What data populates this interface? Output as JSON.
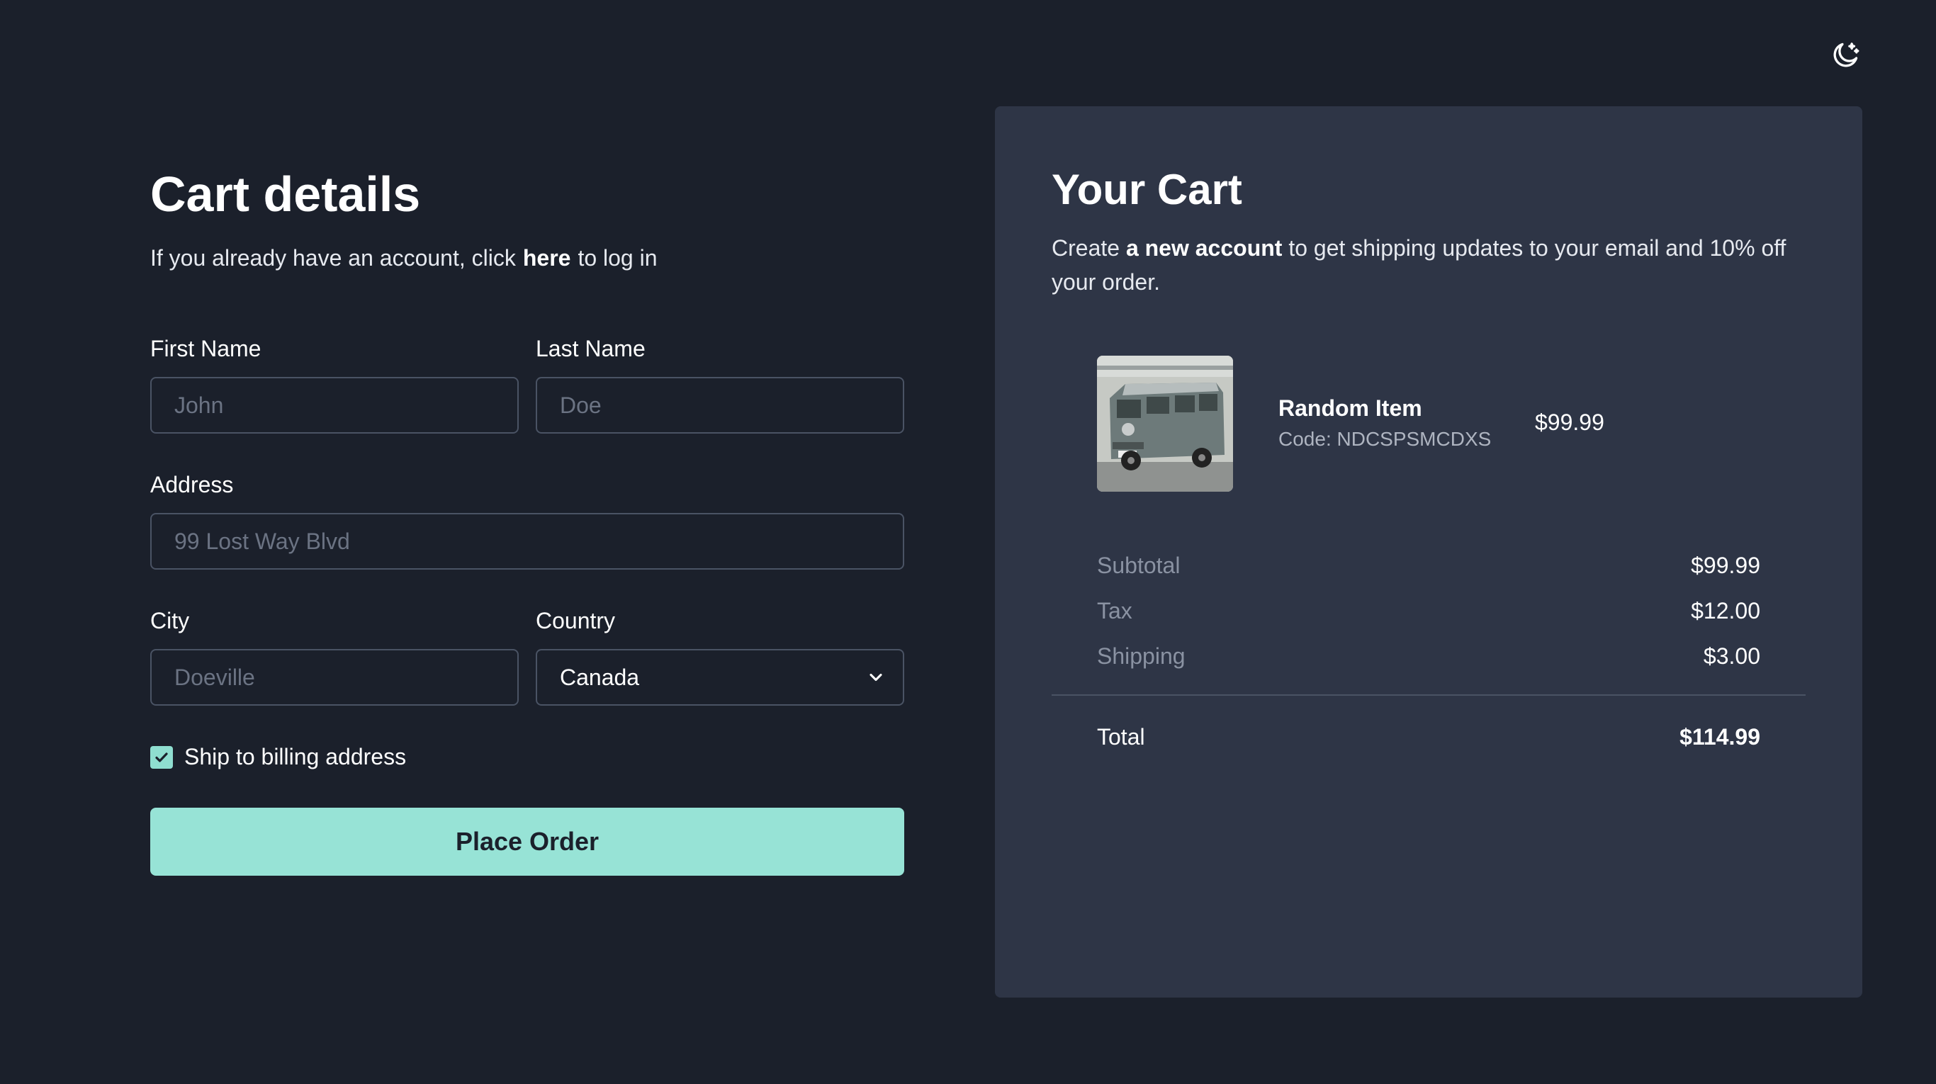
{
  "header": {
    "theme_toggle_icon": "moon-icon"
  },
  "checkout": {
    "title": "Cart details",
    "login_prompt_before": "If you already have an account, click",
    "login_link": "here",
    "login_prompt_after": "to log in",
    "first_name": {
      "label": "First Name",
      "placeholder": "John"
    },
    "last_name": {
      "label": "Last Name",
      "placeholder": "Doe"
    },
    "address": {
      "label": "Address",
      "placeholder": "99 Lost Way Blvd"
    },
    "city": {
      "label": "City",
      "placeholder": "Doeville"
    },
    "country": {
      "label": "Country",
      "value": "Canada"
    },
    "ship_to_billing": {
      "label": "Ship to billing address",
      "checked": true
    },
    "place_order_label": "Place Order"
  },
  "cart": {
    "title": "Your Cart",
    "promo_before": "Create",
    "promo_link": "a new account",
    "promo_after": "to get shipping updates to your email and 10% off your order.",
    "items": [
      {
        "name": "Random Item",
        "code": "Code: NDCSPSMCDXS",
        "price": "$99.99",
        "thumbnail_icon": "van-photo"
      }
    ],
    "summary": {
      "subtotal_label": "Subtotal",
      "subtotal_value": "$99.99",
      "tax_label": "Tax",
      "tax_value": "$12.00",
      "shipping_label": "Shipping",
      "shipping_value": "$3.00",
      "total_label": "Total",
      "total_value": "$114.99"
    }
  },
  "colors": {
    "background": "#1b202b",
    "panel": "#2e3546",
    "accent": "#97e3d6",
    "input_border": "#4a5364"
  }
}
